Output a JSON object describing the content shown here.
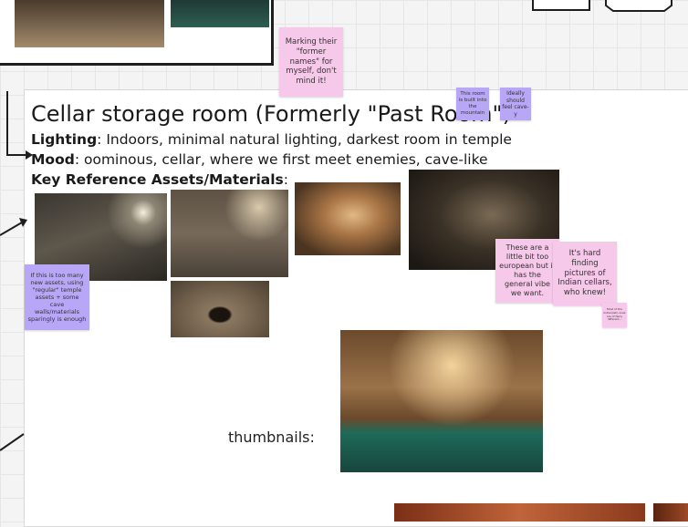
{
  "board": {
    "title": "Cellar storage room (Formerly \"Past Room\")",
    "lighting_label": "Lighting",
    "lighting_text": ": Indoors, minimal natural lighting, darkest room in temple",
    "mood_label": "Mood",
    "mood_text": ": oominous, cellar, where we first meet enemies, cave-like",
    "assets_label": "Key Reference Assets/Materials",
    "assets_colon": ":",
    "thumbnails_label": "thumbnails:"
  },
  "stickies": {
    "former_names": "Marking their \"former names\" for myself, don't mind it!",
    "built_into_mountain": "This room is built into the mountain",
    "feel_cave": "Ideally should feel cave-y",
    "too_european": "These are a little bit too european but it has the general vibe we want.",
    "indian_cellars": "It's hard finding pictures of Indian cellars, who knew!",
    "tiny_note": "Most of the Indian(ish) ones are of fairly different...",
    "too_many_assets": "If this is too many new assets, using \"regular\" temple assets + some cave walls/materials sparingly is enough"
  },
  "colors": {
    "sticky_pink": "#f6c9ea",
    "sticky_purple": "#b8a6f7",
    "connector": "#1e1e1e"
  },
  "icons": {
    "arrow": "arrow-connector-icon"
  }
}
